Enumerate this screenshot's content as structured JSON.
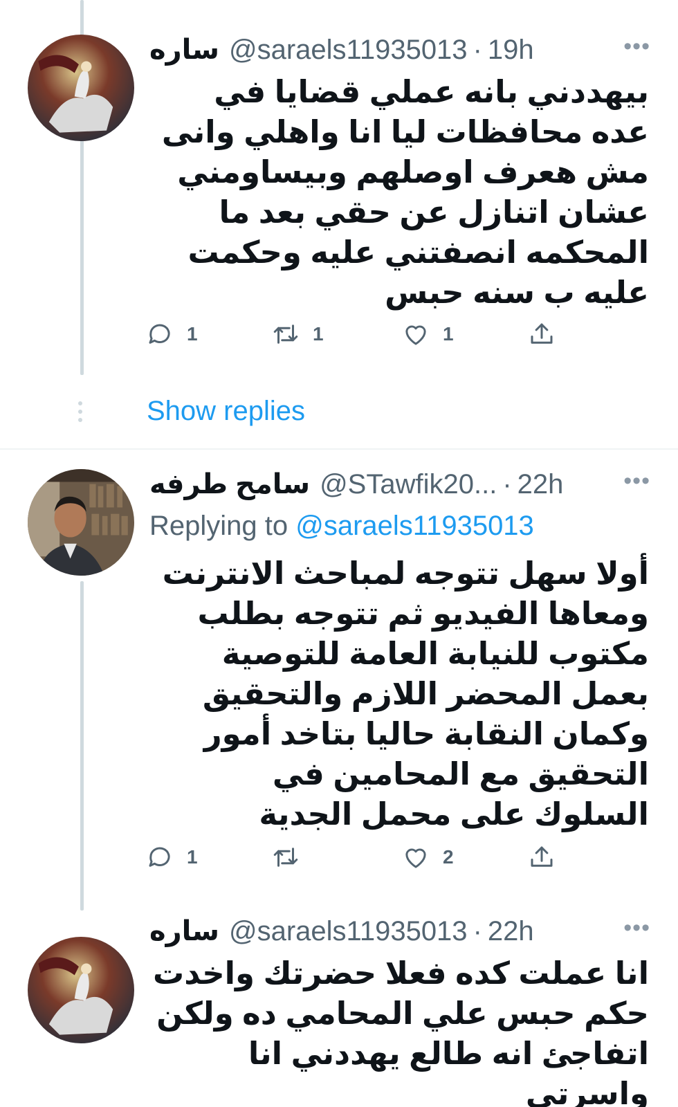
{
  "tweets": [
    {
      "name": "ساره",
      "handle": "@saraels11935013",
      "time": "19h",
      "text": "بيهددني بانه عملي قضايا في عده محافظات ليا انا واهلي وانى مش هعرف اوصلهم وبيساومني عشان اتنازل عن حقي بعد ما المحكمه انصفتني عليه وحكمت عليه ب سنه حبس",
      "reply_count": "1",
      "retweet_count": "1",
      "like_count": "1"
    },
    {
      "name": "سامح طرفه",
      "handle": "@STawfik20...",
      "time": "22h",
      "replying_label": "Replying to",
      "replying_handle": "@saraels11935013",
      "text": "أولا سهل تتوجه لمباحث الانترنت ومعاها الفيديو ثم تتوجه بطلب مكتوب للنيابة العامة للتوصية بعمل المحضر اللازم والتحقيق وكمان النقابة حاليا بتاخد أمور التحقيق مع المحامين في السلوك على محمل الجدية",
      "reply_count": "1",
      "retweet_count": "",
      "like_count": "2"
    },
    {
      "name": "ساره",
      "handle": "@saraels11935013",
      "time": "22h",
      "text": "انا عملت كده فعلا حضرتك واخدت حكم حبس علي المحامي ده ولكن اتفاجئ انه طالع يهددني انا واسرتي"
    }
  ],
  "show_replies_label": "Show replies",
  "more_glyph": "•••",
  "dot_sep": "·",
  "icons": [
    "reply-icon",
    "retweet-icon",
    "like-icon",
    "share-icon",
    "more-icon"
  ],
  "colors": {
    "link": "#1d9bf0",
    "secondary": "#536471",
    "thread_line": "#cfd9de"
  }
}
